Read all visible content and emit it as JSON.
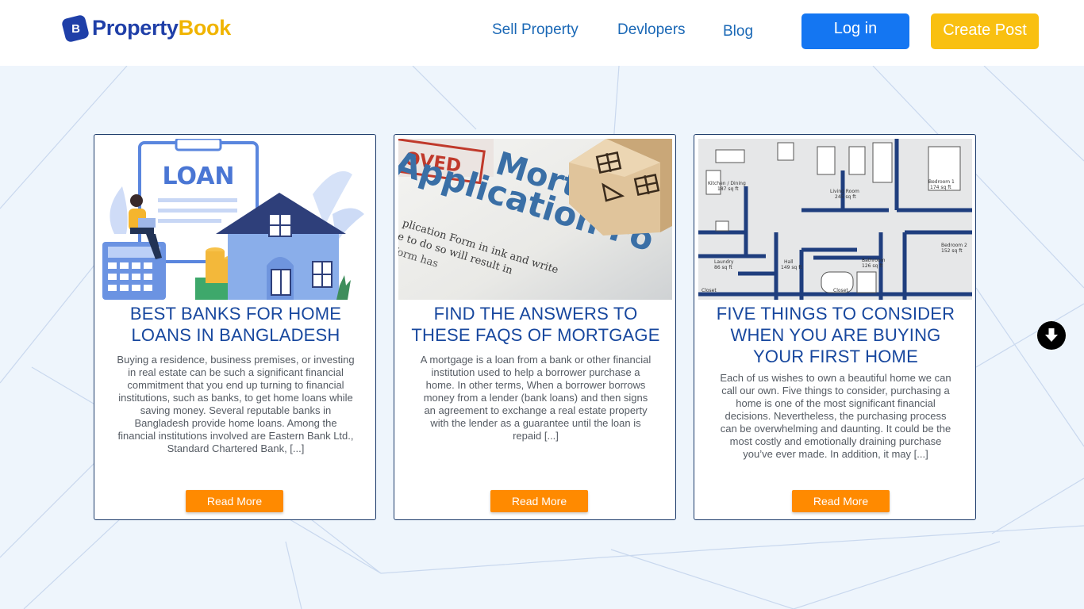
{
  "brand": {
    "part1": "Property",
    "part2": "Book",
    "mark": "B"
  },
  "nav": {
    "sell": "Sell Property",
    "developers": "Devlopers",
    "blog": "Blog"
  },
  "auth": {
    "login": "Log in",
    "create_post": "Create Post"
  },
  "posts": [
    {
      "title": "BEST BANKS FOR HOME LOANS IN BANGLADESH",
      "excerpt": "Buying a residence, business premises, or investing in real estate can be such a significant financial commitment that you end up turning to financial institutions, such as banks, to get home loans while saving money. Several reputable banks in Bangladesh provide home loans. Among the financial institutions involved are Eastern Bank Ltd., Standard Chartered Bank, [...]",
      "read_more": "Read More",
      "image": {
        "word": "LOAN"
      }
    },
    {
      "title": "FIND THE ANSWERS TO THESE FAQS OF MORTGAGE",
      "excerpt": "A mortgage is a loan from a bank or other financial institution used to help a borrower purchase a home. In other terms, When a borrower borrows money from a lender (bank loans) and then signs an agreement to exchange a real estate property with the lender as a guarantee until the loan is repaid [...]",
      "read_more": "Read More",
      "image": {
        "stamp": "OVED",
        "line1": "Mortgage",
        "line2": "Application Fo",
        "small1": "plication Form in ink and write",
        "small2": "e to do so will result in",
        "small3": "form has"
      }
    },
    {
      "title": "FIVE THINGS TO CONSIDER WHEN YOU ARE BUYING YOUR FIRST HOME",
      "excerpt": "Each of us wishes to own a beautiful home we can call our own. Five things to consider, purchasing a home is one of the most significant financial decisions. Nevertheless, the purchasing process can be overwhelming and daunting. It could be the most costly and emotionally draining purchase you’ve ever made. In addition, it may [...]",
      "read_more": "Read More",
      "image": {
        "rooms": [
          {
            "name": "Kitchen / Dining",
            "area": "187 sq ft"
          },
          {
            "name": "Living Room",
            "area": "245 sq ft"
          },
          {
            "name": "Bedroom 1",
            "area": "174 sq ft"
          },
          {
            "name": "Bedroom 2",
            "area": "152 sq ft"
          },
          {
            "name": "Laundry",
            "area": "86 sq ft"
          },
          {
            "name": "Hall",
            "area": "149 sq ft"
          },
          {
            "name": "Bathroom",
            "area": "126 sq ft"
          },
          {
            "name": "Closet",
            "area": ""
          },
          {
            "name": "Closet",
            "area": ""
          }
        ]
      }
    }
  ],
  "icons": {
    "scroll": "arrow-down-circle-icon",
    "logo": "logo-mark-icon"
  },
  "colors": {
    "primary": "#1476f2",
    "accent": "#f9c011",
    "read_more": "#ff8a00",
    "title": "#17479e"
  }
}
